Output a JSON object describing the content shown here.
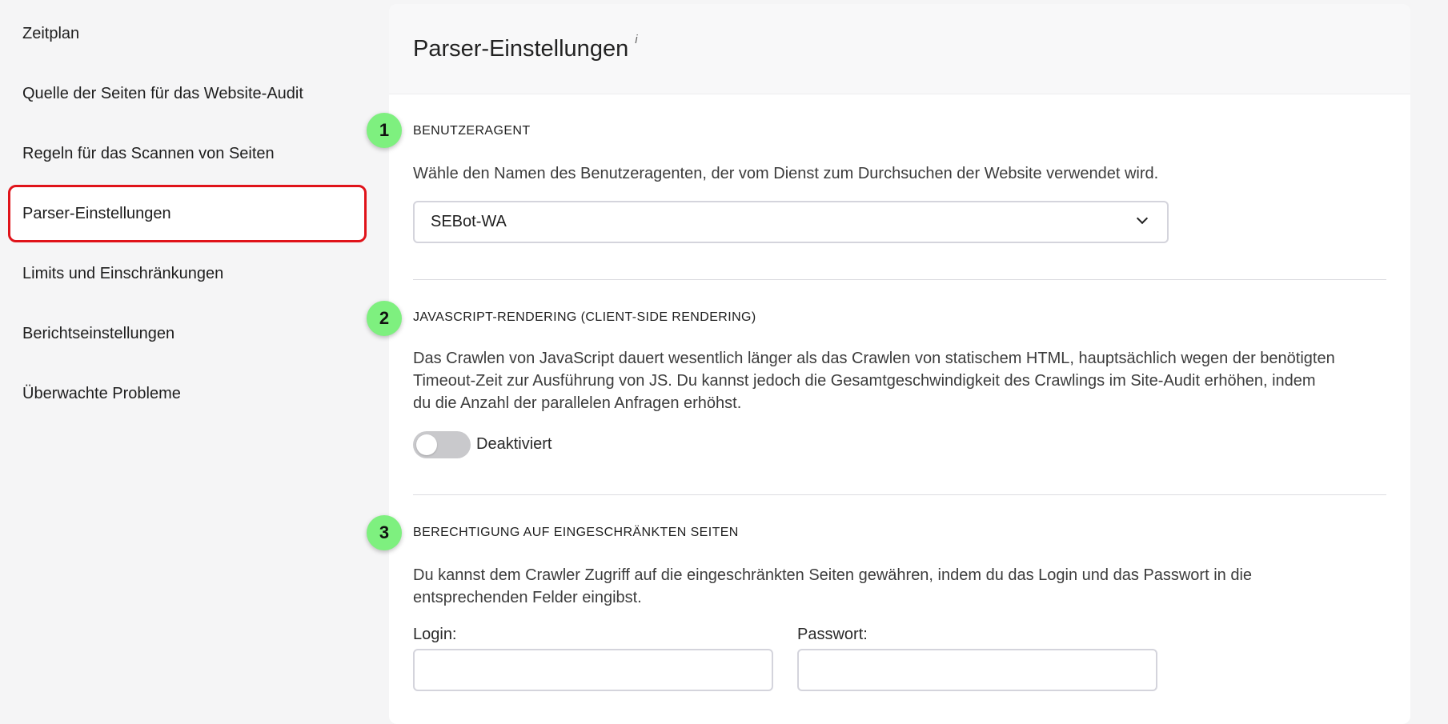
{
  "sidebar": {
    "items": [
      {
        "label": "Zeitplan"
      },
      {
        "label": "Quelle der Seiten für das Website-Audit"
      },
      {
        "label": "Regeln für das Scannen von Seiten"
      },
      {
        "label": "Parser-Einstellungen",
        "active": true
      },
      {
        "label": "Limits und Einschränkungen"
      },
      {
        "label": "Berichtseinstellungen"
      },
      {
        "label": "Überwachte Probleme"
      }
    ]
  },
  "panel": {
    "title": "Parser-Einstellungen",
    "info_mark": "i"
  },
  "sections": {
    "user_agent": {
      "badge": "1",
      "title": "BENUTZERAGENT",
      "description": "Wähle den Namen des Benutzeragenten, der vom Dienst zum Durchsuchen der Website verwendet wird.",
      "selected_value": "SEBot-WA"
    },
    "js_rendering": {
      "badge": "2",
      "title": "JAVASCRIPT-RENDERING (CLIENT-SIDE RENDERING)",
      "description_lines": [
        "Das Crawlen von JavaScript dauert wesentlich länger als das Crawlen von statischem HTML, hauptsächlich wegen der benötigten",
        "Timeout-Zeit zur Ausführung von JS. Du kannst jedoch die Gesamtgeschwindigkeit des Crawlings im Site-Audit erhöhen, indem",
        "du die Anzahl der parallelen Anfragen erhöhst."
      ],
      "toggle_state": "off",
      "toggle_label": "Deaktiviert"
    },
    "auth": {
      "badge": "3",
      "title": "BERECHTIGUNG AUF EINGESCHRÄNKTEN SEITEN",
      "description_lines": [
        "Du kannst dem Crawler Zugriff auf die eingeschränkten Seiten gewähren, indem du das Login und das Passwort in die",
        "entsprechenden Felder eingibst."
      ],
      "login_label": "Login:",
      "login_value": "",
      "password_label": "Passwort:",
      "password_value": ""
    }
  },
  "colors": {
    "active_outline": "#e0131a",
    "badge": "#7ef07f",
    "toggle_off": "#c9c9cc"
  }
}
